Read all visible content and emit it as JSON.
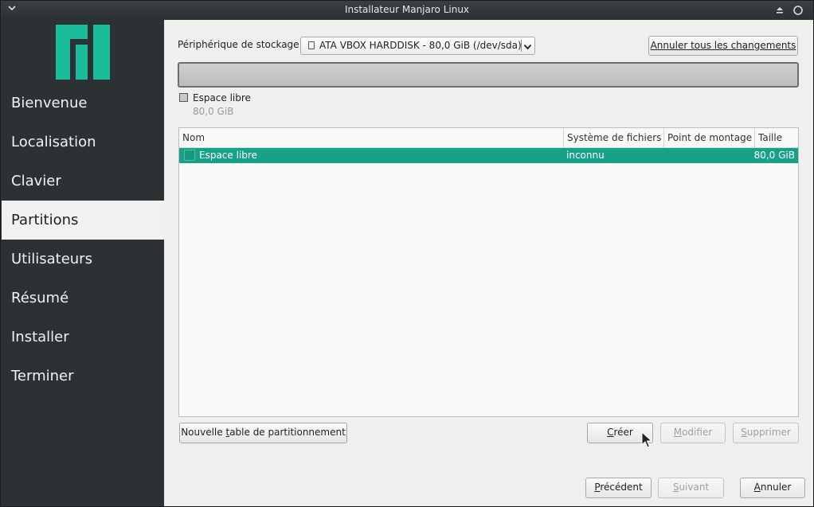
{
  "window": {
    "title": "Installateur Manjaro Linux"
  },
  "colors": {
    "accent": "#17a187",
    "sidebar_bg": "#2c3133",
    "logo": "#1abc9c"
  },
  "sidebar": {
    "items": [
      {
        "label": "Bienvenue",
        "active": false
      },
      {
        "label": "Localisation",
        "active": false
      },
      {
        "label": "Clavier",
        "active": false
      },
      {
        "label": "Partitions",
        "active": true
      },
      {
        "label": "Utilisateurs",
        "active": false
      },
      {
        "label": "Résumé",
        "active": false
      },
      {
        "label": "Installer",
        "active": false
      },
      {
        "label": "Terminer",
        "active": false
      }
    ]
  },
  "storage": {
    "label": "Périphérique de stockage:",
    "selected_device": "ATA VBOX HARDDISK - 80,0 GiB (/dev/sda)",
    "revert_button": "Annuler tous les changements"
  },
  "legend": {
    "label": "Espace libre",
    "size": "80,0 GiB"
  },
  "table": {
    "columns": [
      "Nom",
      "Système de fichiers",
      "Point de montage",
      "Taille"
    ],
    "rows": [
      {
        "name": "Espace libre",
        "filesystem": "inconnu",
        "mountpoint": "",
        "size": "80,0 GiB",
        "selected": true
      }
    ]
  },
  "actions": {
    "new_table": {
      "pre": "Nouvelle ",
      "acc": "t",
      "post": "able de partitionnement"
    },
    "create": {
      "pre": "",
      "acc": "C",
      "post": "réer"
    },
    "modify": {
      "pre": "",
      "acc": "M",
      "post": "odifier"
    },
    "delete": {
      "pre": "",
      "acc": "S",
      "post": "upprimer"
    }
  },
  "nav_buttons": {
    "previous": {
      "pre": "",
      "acc": "P",
      "post": "récédent"
    },
    "next": {
      "pre": "",
      "acc": "S",
      "post": "uivant"
    },
    "cancel": {
      "pre": "",
      "acc": "A",
      "post": "nnuler"
    }
  }
}
